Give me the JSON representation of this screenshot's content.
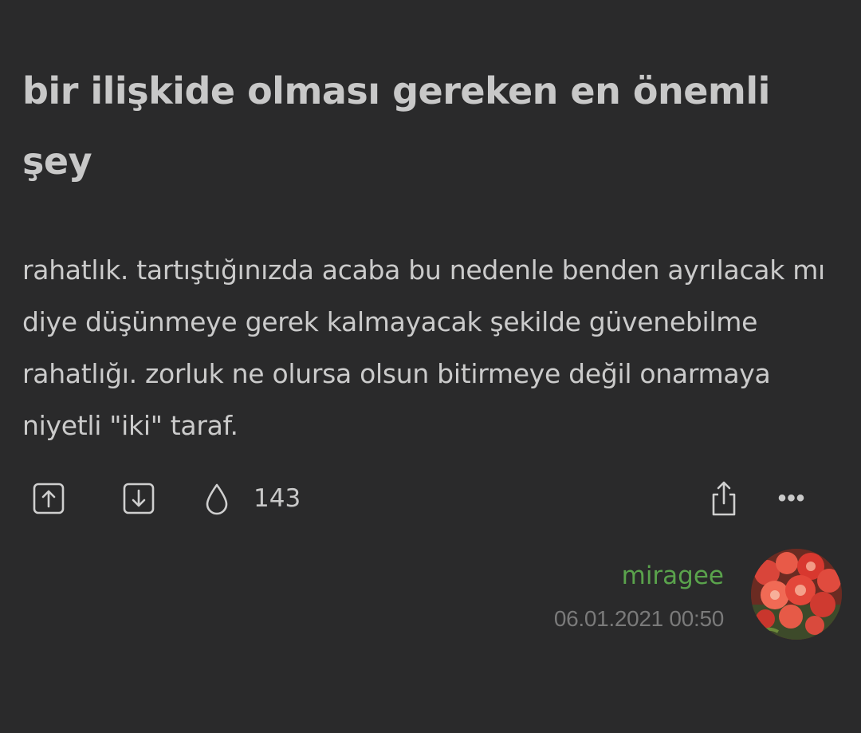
{
  "post": {
    "title": "bir ilişkide olması gereken en önemli şey",
    "body": "rahatlık. tartıştığınızda acaba bu nedenle benden ayrılacak mı diye düşünmeye gerek kalmayacak şekilde güvenebilme rahatlığı. zorluk ne olursa olsun bitirmeye değil onarmaya niyetli \"iki\" taraf."
  },
  "actions": {
    "upvote_icon": "arrow-up-box-icon",
    "downvote_icon": "arrow-down-box-icon",
    "drop_icon": "drop-icon",
    "count": "143",
    "share_icon": "share-icon",
    "more_label": "•••"
  },
  "author": {
    "name": "miragee",
    "date": "06.01.2021 00:50",
    "name_color": "#5aa34c"
  },
  "colors": {
    "background": "#2a2a2b",
    "text": "#cbcbcb",
    "muted": "#7a7a7a"
  }
}
